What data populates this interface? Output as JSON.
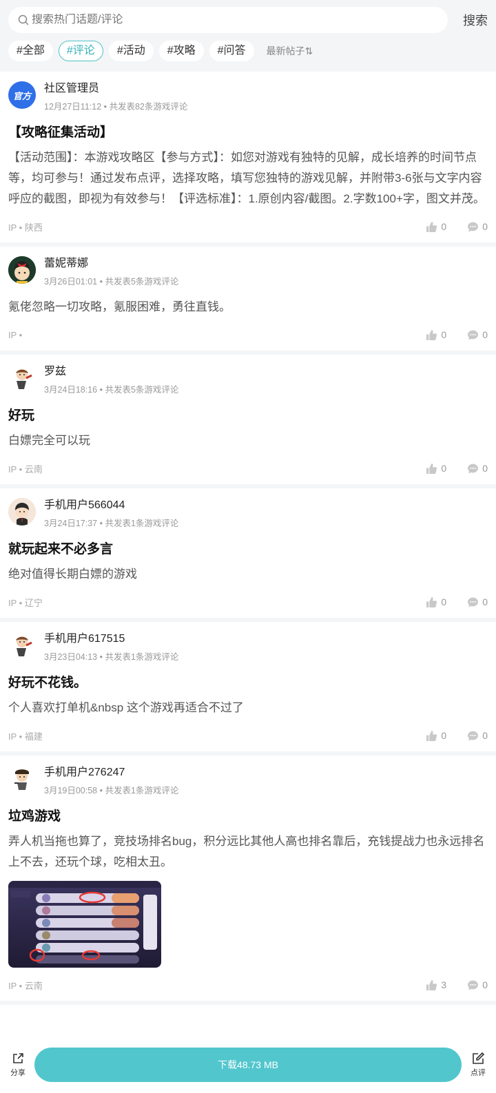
{
  "search": {
    "placeholder": "搜索热门话题/评论",
    "button": "搜索"
  },
  "tags": [
    "#全部",
    "#评论",
    "#活动",
    "#攻略",
    "#问答"
  ],
  "sort_label": "最新帖子⇅",
  "posts": [
    {
      "name": "社区管理员",
      "meta": "12月27日11:12 • 共发表82条游戏评论",
      "title": "【攻略征集活动】",
      "body": "【活动范围】：本游戏攻略区【参与方式】：如您对游戏有独特的见解，成长培养的时间节点等，均可参与！通过发布点评，选择攻略，填写您独特的游戏见解，并附带3-6张与文字内容呼应的截图，即视为有效参与！【评选标准】：1.原创内容/截图。2.字数100+字，图文并茂。",
      "ip": "IP • 陕西",
      "likes": "0",
      "comments": "0",
      "avatar_text": "官方"
    },
    {
      "name": "蕾妮蒂娜",
      "meta": "3月26日01:01 • 共发表5条游戏评论",
      "title": "",
      "body": "氪佬忽略一切攻略，氪服困难，勇往直钱。",
      "ip": "IP •",
      "likes": "0",
      "comments": "0"
    },
    {
      "name": "罗兹",
      "meta": "3月24日18:16 • 共发表5条游戏评论",
      "title": "好玩",
      "body": "白嫖完全可以玩",
      "ip": "IP • 云南",
      "likes": "0",
      "comments": "0"
    },
    {
      "name": "手机用户566044",
      "meta": "3月24日17:37 • 共发表1条游戏评论",
      "title": "就玩起来不必多言",
      "body": "绝对值得长期白嫖的游戏",
      "ip": "IP • 辽宁",
      "likes": "0",
      "comments": "0"
    },
    {
      "name": "手机用户617515",
      "meta": "3月23日04:13 • 共发表1条游戏评论",
      "title": "好玩不花钱。",
      "body": "个人喜欢打单机&nbsp 这个游戏再适合不过了",
      "ip": "IP • 福建",
      "likes": "0",
      "comments": "0"
    },
    {
      "name": "手机用户276247",
      "meta": "3月19日00:58 • 共发表1条游戏评论",
      "title": "垃鸡游戏",
      "body": "弄人机当拖也算了，竞技场排名bug，积分远比其他人高也排名靠后，充钱提战力也永远排名上不去，还玩个球，吃相太丑。",
      "ip": "IP • 云南",
      "likes": "3",
      "comments": "0"
    }
  ],
  "bottom": {
    "share": "分享",
    "download": "下载48.73 MB",
    "review": "点评"
  },
  "colors": {
    "accent": "#52c6cd",
    "tag_active": "#36b2b8",
    "official_avatar": "#2f6fe8"
  }
}
